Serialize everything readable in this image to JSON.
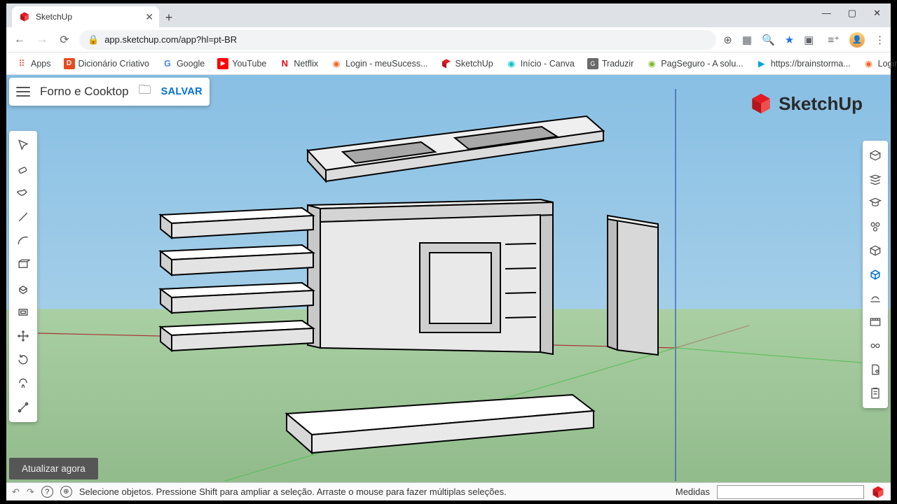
{
  "browser": {
    "tab_title": "SketchUp",
    "url": "app.sketchup.com/app?hl=pt-BR",
    "window_controls": {
      "min": "—",
      "max": "▢",
      "close": "✕"
    }
  },
  "bookmarks": [
    {
      "icon": "grid",
      "label": "Apps",
      "color": "#5f6368"
    },
    {
      "icon": "D",
      "label": "Dicionário Criativo",
      "color": "#e84b1f"
    },
    {
      "icon": "G",
      "label": "Google",
      "color": "#4285f4"
    },
    {
      "icon": "▶",
      "label": "YouTube",
      "color": "#ff0000"
    },
    {
      "icon": "N",
      "label": "Netflix",
      "color": "#e50914"
    },
    {
      "icon": "◉",
      "label": "Login - meuSucess...",
      "color": "#f26522"
    },
    {
      "icon": "S",
      "label": "SketchUp",
      "color": "#e31b23"
    },
    {
      "icon": "C",
      "label": "Início - Canva",
      "color": "#00c4cc"
    },
    {
      "icon": "G",
      "label": "Traduzir",
      "color": "#6a6a6a"
    },
    {
      "icon": "◉",
      "label": "PagSeguro - A solu...",
      "color": "#7ab929"
    },
    {
      "icon": "▶",
      "label": "https://brainstorma...",
      "color": "#00a3e0"
    },
    {
      "icon": "◉",
      "label": "Login",
      "color": "#f26522"
    }
  ],
  "app": {
    "file_title": "Forno e Cooktop",
    "save_label": "SALVAR",
    "product": "SketchUp",
    "update_button": "Atualizar agora",
    "status_hint": "Selecione objetos. Pressione Shift para ampliar a seleção. Arraste o mouse para fazer múltiplas seleções.",
    "measure_label": "Medidas"
  },
  "left_tools": [
    "select",
    "eraser",
    "paint",
    "line",
    "arc",
    "rectangle",
    "pushpull",
    "offset",
    "move",
    "rotate",
    "scale",
    "tape"
  ],
  "right_tools": [
    "views",
    "layers",
    "instructor",
    "components",
    "styles",
    "materials",
    "softshadow",
    "scenes",
    "display",
    "entity",
    "report"
  ]
}
